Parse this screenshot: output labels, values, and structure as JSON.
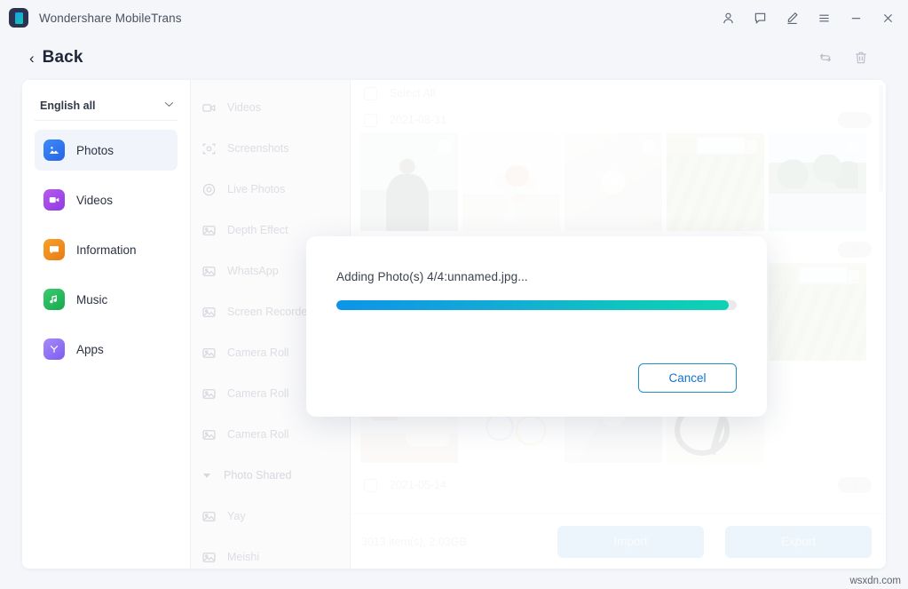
{
  "window": {
    "app_title": "Wondershare MobileTrans",
    "logo_icon": "mobiletrans-logo-icon",
    "controls": [
      {
        "name": "account-icon",
        "label": "Account"
      },
      {
        "name": "feedback-icon",
        "label": "Feedback"
      },
      {
        "name": "edit-pen-icon",
        "label": "Edit"
      },
      {
        "name": "menu-icon",
        "label": "Menu"
      },
      {
        "name": "minimize-icon",
        "label": "Minimize"
      },
      {
        "name": "close-icon",
        "label": "Close"
      }
    ]
  },
  "header": {
    "back_chevron": "‹",
    "back_label": "Back",
    "tools": [
      {
        "name": "refresh-icon",
        "label": "Refresh"
      },
      {
        "name": "trash-icon",
        "label": "Delete"
      }
    ]
  },
  "sidebar": {
    "language": {
      "label": "English all",
      "caret": "⌄"
    },
    "items": [
      {
        "label": "Photos",
        "icon": "photos-icon",
        "active": true
      },
      {
        "label": "Videos",
        "icon": "videos-icon",
        "active": false
      },
      {
        "label": "Information",
        "icon": "information-icon",
        "active": false
      },
      {
        "label": "Music",
        "icon": "music-icon",
        "active": false
      },
      {
        "label": "Apps",
        "icon": "apps-icon",
        "active": false
      }
    ]
  },
  "categories": [
    {
      "label": "Videos",
      "icon": "video-camera-icon"
    },
    {
      "label": "Screenshots",
      "icon": "screenshot-icon"
    },
    {
      "label": "Live Photos",
      "icon": "live-photo-icon"
    },
    {
      "label": "Depth Effect",
      "icon": "photo-icon"
    },
    {
      "label": "WhatsApp",
      "icon": "photo-icon"
    },
    {
      "label": "Screen Recorder",
      "icon": "photo-icon"
    },
    {
      "label": "Camera Roll",
      "icon": "photo-icon"
    },
    {
      "label": "Camera Roll",
      "icon": "photo-icon"
    },
    {
      "label": "Camera Roll",
      "icon": "photo-icon"
    },
    {
      "label": "Photo Shared",
      "icon": "caret-down-icon",
      "group": true
    },
    {
      "label": "Yay",
      "icon": "photo-icon"
    },
    {
      "label": "Meishi",
      "icon": "photo-icon"
    }
  ],
  "grid": {
    "select_all_label": "Select All",
    "groups": [
      {
        "date": "2021-08-31",
        "count": "5",
        "thumbs": [
          {
            "name": "thumb-person",
            "kind": "photo"
          },
          {
            "name": "thumb-flowers",
            "kind": "photo"
          },
          {
            "name": "thumb-video-1",
            "kind": "video"
          },
          {
            "name": "thumb-garden",
            "kind": "photo"
          },
          {
            "name": "thumb-beach",
            "kind": "photo"
          }
        ]
      },
      {
        "date": "",
        "count": "9",
        "thumbs": [
          {
            "name": "thumb-totoro",
            "kind": "photo"
          },
          {
            "name": "thumb-chart",
            "kind": "photo"
          },
          {
            "name": "thumb-video-2",
            "kind": "video"
          },
          {
            "name": "thumb-cable",
            "kind": "photo"
          },
          {
            "name": "thumb-garden-2",
            "kind": "photo"
          }
        ]
      }
    ],
    "bottom_date": "2021-05-14",
    "bottom_count": "3"
  },
  "actions": {
    "item_summary": "3013 item(s), 2.03GB",
    "import_label": "Import",
    "export_label": "Export"
  },
  "modal": {
    "message": "Adding Photo(s) 4/4:unnamed.jpg...",
    "progress_percent": 98,
    "cancel_label": "Cancel"
  },
  "watermark": "wsxdn.com",
  "colors": {
    "accent_blue": "#1572c9",
    "progress_start": "#0d94e8",
    "progress_end": "#0fd2b3",
    "page_bg": "#f4f6fa"
  }
}
